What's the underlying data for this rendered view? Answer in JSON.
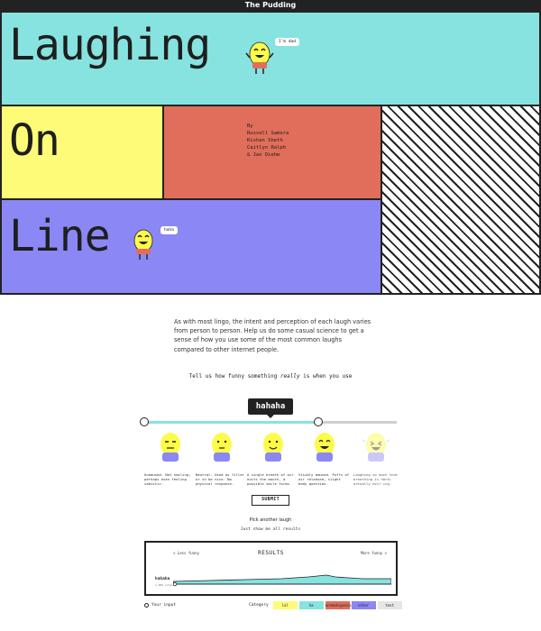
{
  "site": {
    "brand": "The Pudding"
  },
  "hero": {
    "words": [
      "Laughing",
      "On",
      "Line"
    ],
    "bubble_top": "I'm dad",
    "bubble_line": "haha",
    "byline": "By",
    "authors": [
      "Russell Samora",
      "Kishan Sheth",
      "Caitlyn Ralph",
      "& Jan Diehm"
    ]
  },
  "intro": {
    "text": "As with most lingo, the intent and perception of each laugh varies from person to person. Help us do some casual science to get a sense of how you use some of the most common laughs compared to other internet people."
  },
  "quiz": {
    "prompt_before": "Tell us how funny something ",
    "prompt_emph": "really",
    "prompt_after": " is when you use",
    "current_word": "hahaha",
    "slider_value": 0.69,
    "faces": [
      {
        "icon": "unamused-face-icon",
        "desc": "Unamused. Not smiling; perhaps even feeling sadistic."
      },
      {
        "icon": "neutral-face-icon",
        "desc": "Neutral. Used as filler or to be nice. No physical response."
      },
      {
        "icon": "smile-face-icon",
        "desc": "A single breath of air exits the mouth, a possible smile forms."
      },
      {
        "icon": "amused-face-icon",
        "desc": "Visibly amused. Puffs of air released, slight body question."
      },
      {
        "icon": "laughing-face-icon",
        "desc": "Laughing so much that breathing is hard; actually evil ing."
      }
    ],
    "submit_label": "SUBMIT",
    "pick_another": "Pick another laugh",
    "show_all": "Just show me all results"
  },
  "results": {
    "title": "RESULTS",
    "less_funny": "< Less funny",
    "more_funny": "More funny >",
    "word_label": "hahaha",
    "sub_label": "1,000 votes",
    "your_input": "Your input",
    "category_label": "Category",
    "categories": [
      {
        "name": "lol",
        "color": "#fdfb78"
      },
      {
        "name": "ha",
        "color": "#86e3e0"
      },
      {
        "name": "onomatopoeia",
        "color": "#e06e5a"
      },
      {
        "name": "other",
        "color": "#8b87f5"
      },
      {
        "name": "text",
        "color": "#e6e6e6"
      }
    ]
  },
  "colors": {
    "cyan": "#86e3e0",
    "yellow": "#fdfb78",
    "coral": "#e06e5a",
    "purple": "#8b87f5",
    "ink": "#222222"
  }
}
